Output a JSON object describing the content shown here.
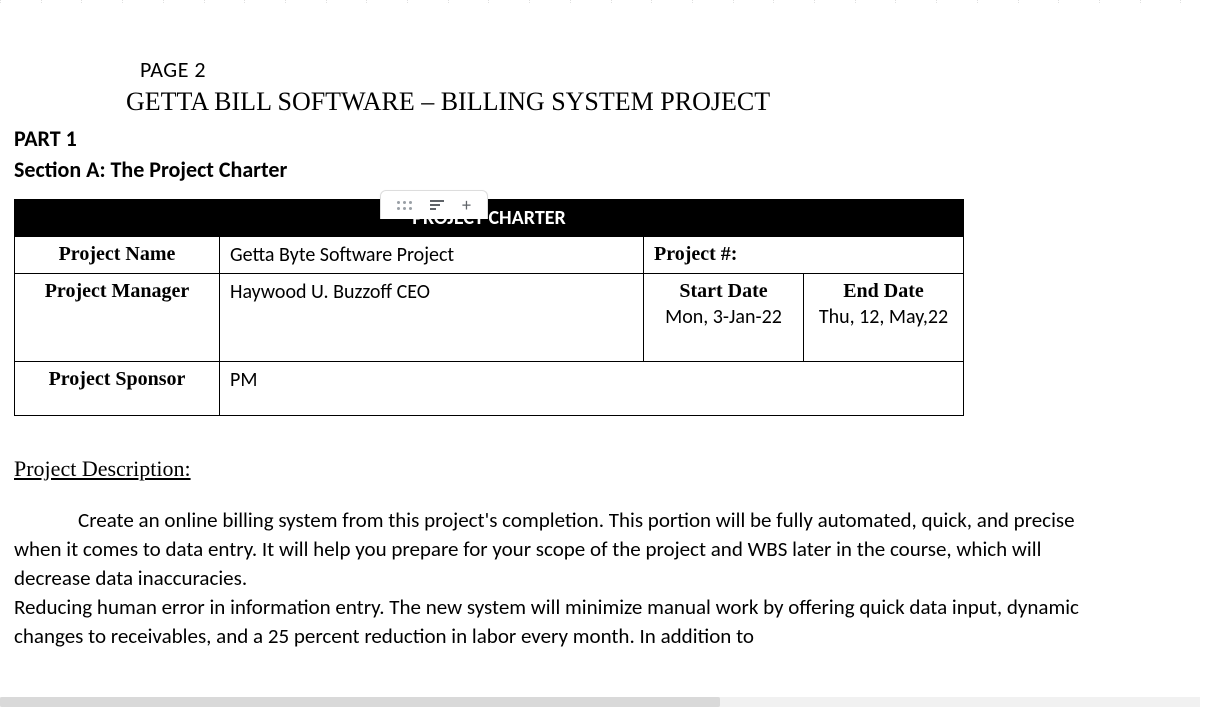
{
  "page_number": "PAGE 2",
  "doc_title": "GETTA BILL SOFTWARE – BILLING SYSTEM PROJECT",
  "part_label": "PART 1",
  "section_label": "Section A: The Project Charter",
  "charter": {
    "header": "PROJECT CHARTER",
    "labels": {
      "project_name": "Project Name",
      "project_number": "Project #:",
      "project_manager": "Project Manager",
      "start_date": "Start Date",
      "end_date": "End Date",
      "project_sponsor": "Project Sponsor"
    },
    "values": {
      "project_name": "Getta Byte Software Project",
      "project_number": "",
      "project_manager": "Haywood U. Buzzoff CEO",
      "start_date": "Mon, 3-Jan-22",
      "end_date": "Thu, 12, May,22",
      "project_sponsor": "PM"
    }
  },
  "description": {
    "heading": "Project Description:",
    "body": "Create an online billing system from this project's completion. This portion will be fully automated, quick, and precise when it comes to data entry. It will help you prepare for your scope of the project and WBS later in the course, which will decrease data inaccuracies.\nReducing human error in information entry. The new system will minimize manual work by offering quick data input, dynamic changes to receivables, and a 25 percent reduction in labor every month. In addition to"
  },
  "toolbar": {
    "drag": "drag-handle",
    "filter": "filter",
    "add": "+"
  }
}
